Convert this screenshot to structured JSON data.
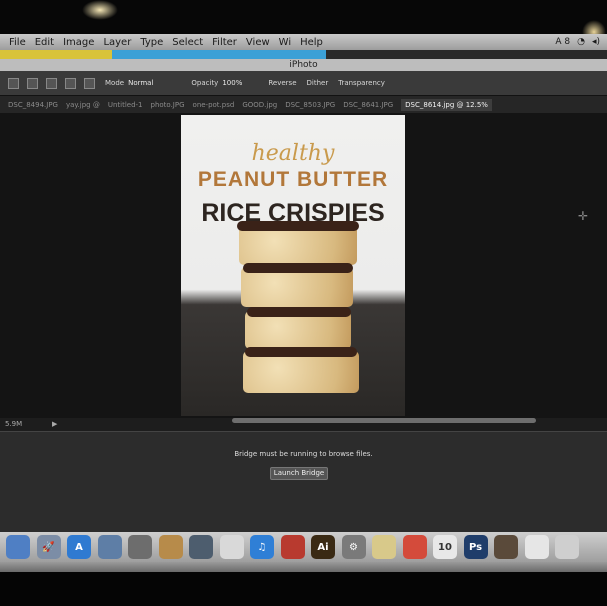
{
  "menubar": {
    "items": [
      "File",
      "Edit",
      "Image",
      "Layer",
      "Type",
      "Select",
      "Filter",
      "View",
      "Wi",
      "Help"
    ],
    "status": "A 8"
  },
  "window_title": "iPhoto",
  "options": {
    "mode_label": "Mode",
    "mode_value": "Normal",
    "opacity_label": "Opacity",
    "opacity_value": "100%",
    "reverse": "Reverse",
    "dither": "Dither",
    "transparency": "Transparency"
  },
  "tabs": [
    "DSC_8494.JPG",
    "yay.jpg @",
    "Untitled-1",
    "photo.JPG",
    "one-pot.psd",
    "GOOD.jpg",
    "DSC_8503.JPG",
    "DSC_8641.JPG",
    "DSC_8614.jpg @ 12.5%"
  ],
  "document": {
    "line1": "healthy",
    "line2": "PEANUT BUTTER",
    "line3": "RICE CRISPIES"
  },
  "statusbar": {
    "size": "5.9M"
  },
  "bridge": {
    "message": "Bridge must be running to browse files.",
    "button": "Launch Bridge"
  },
  "dock": {
    "icons": [
      {
        "name": "finder-icon",
        "glyph": "",
        "color": "#4f7fc4"
      },
      {
        "name": "launchpad-icon",
        "glyph": "🚀",
        "color": "#7c8da6"
      },
      {
        "name": "app-store-icon",
        "glyph": "A",
        "color": "#2f7ad1"
      },
      {
        "name": "preview-icon",
        "glyph": "",
        "color": "#5e7ea6"
      },
      {
        "name": "photo-booth-icon",
        "glyph": "",
        "color": "#6d6d6d"
      },
      {
        "name": "contacts-icon",
        "glyph": "",
        "color": "#b78b4a"
      },
      {
        "name": "iphoto-icon",
        "glyph": "",
        "color": "#4d5d6e"
      },
      {
        "name": "calculator-icon",
        "glyph": "",
        "color": "#d9d9d9"
      },
      {
        "name": "itunes-icon",
        "glyph": "♫",
        "color": "#2f7fd6"
      },
      {
        "name": "photo-app-icon",
        "glyph": "",
        "color": "#b83a2f"
      },
      {
        "name": "illustrator-icon",
        "glyph": "Ai",
        "color": "#3a2a14"
      },
      {
        "name": "system-preferences-icon",
        "glyph": "⚙",
        "color": "#7a7a7a"
      },
      {
        "name": "folder-icon",
        "glyph": "",
        "color": "#d8c98a"
      },
      {
        "name": "chrome-icon",
        "glyph": "",
        "color": "#d44b3b"
      },
      {
        "name": "calendar-icon",
        "glyph": "10",
        "color": "#e8e8e8"
      },
      {
        "name": "photoshop-icon",
        "glyph": "Ps",
        "color": "#1f3d6a"
      },
      {
        "name": "photo-viewer-icon",
        "glyph": "",
        "color": "#5a4a3a"
      },
      {
        "name": "document-icon",
        "glyph": "",
        "color": "#e6e6e6"
      },
      {
        "name": "trash-icon",
        "glyph": "",
        "color": "#cfcfcf"
      }
    ]
  }
}
